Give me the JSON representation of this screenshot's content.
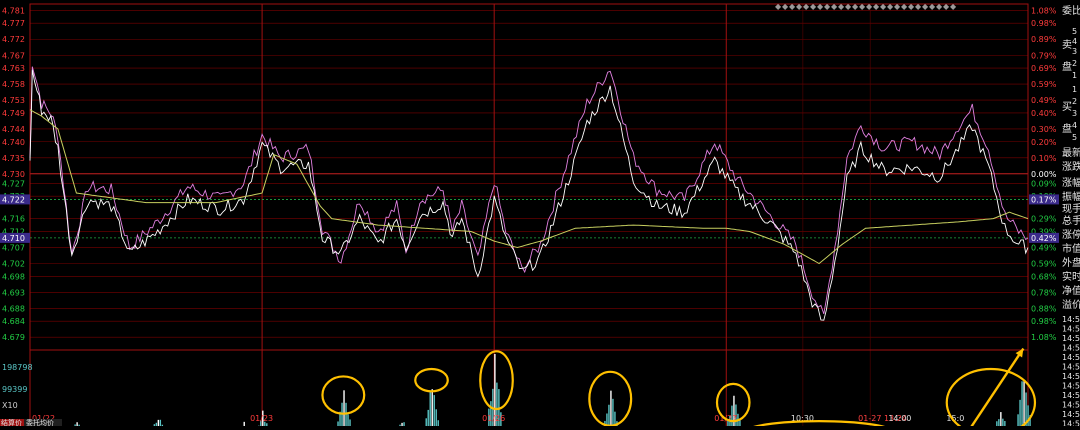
{
  "chart_data": {
    "type": "line",
    "title": "",
    "xlabel": "",
    "ylabel": "",
    "ylim": [
      4.675,
      4.783
    ],
    "pct_ylim": [
      -1.08,
      1.08
    ],
    "base_price": 4.73,
    "grid": true,
    "y_ticks": [
      4.781,
      4.777,
      4.772,
      4.767,
      4.763,
      4.758,
      4.753,
      4.749,
      4.744,
      4.74,
      4.735,
      4.73,
      4.727,
      4.723,
      4.716,
      4.712,
      4.707,
      4.702,
      4.698,
      4.693,
      4.688,
      4.684,
      4.679
    ],
    "y_tick_labels": [
      "4.781",
      "4.777",
      "4.772",
      "4.767",
      "4.763",
      "4.758",
      "4.753",
      "4.749",
      "4.744",
      "4.740",
      "4.735",
      "4.730",
      "4.727",
      "4.723",
      "4.716",
      "4.712",
      "4.707",
      "4.702",
      "4.698",
      "4.693",
      "4.688",
      "4.684",
      "4.679"
    ],
    "pct_ticks": [
      "1.08%",
      "0.98%",
      "0.89%",
      "0.79%",
      "0.69%",
      "0.59%",
      "0.49%",
      "0.40%",
      "0.30%",
      "0.20%",
      "0.10%",
      "0.00%",
      "0.09%",
      "0.19%",
      "0.29%",
      "0.39%",
      "0.49%",
      "0.59%",
      "0.68%",
      "0.78%",
      "0.88%",
      "0.98%",
      "1.08%"
    ],
    "highlight_levels": [
      {
        "value": 4.722,
        "label": "4.722",
        "pct_label": "0.17%",
        "color": "#3a2a8a"
      },
      {
        "value": 4.71,
        "label": "4.710",
        "pct_label": "0.42%",
        "color": "#3a2a8a"
      }
    ],
    "x_labels": [
      {
        "day": 0,
        "label": "01/22"
      },
      {
        "day": 1,
        "label": "01/23"
      },
      {
        "day": 2,
        "label": "01/26"
      },
      {
        "day": 3,
        "label": "01/27"
      },
      {
        "day": 3.33,
        "label": "10:30"
      },
      {
        "day": 3.62,
        "label": "01-27 13:24"
      },
      {
        "day": 3.75,
        "label": "14:00"
      },
      {
        "day": 4.0,
        "label": "15:0"
      }
    ],
    "volume_ticks": [
      "198798",
      "99399",
      "X10"
    ],
    "volume_ylim": [
      0,
      198798
    ],
    "series": [
      {
        "color": "#e080e0",
        "keypoints": [
          [
            0,
            4.735
          ],
          [
            0.01,
            4.765
          ],
          [
            0.05,
            4.752
          ],
          [
            0.09,
            4.749
          ],
          [
            0.12,
            4.742
          ],
          [
            0.18,
            4.705
          ],
          [
            0.25,
            4.726
          ],
          [
            0.35,
            4.725
          ],
          [
            0.43,
            4.707
          ],
          [
            0.55,
            4.715
          ],
          [
            0.68,
            4.726
          ],
          [
            0.82,
            4.722
          ],
          [
            0.92,
            4.727
          ],
          [
            1.0,
            4.742
          ],
          [
            1.08,
            4.735
          ],
          [
            1.2,
            4.738
          ],
          [
            1.26,
            4.713
          ],
          [
            1.34,
            4.703
          ],
          [
            1.42,
            4.722
          ],
          [
            1.5,
            4.712
          ],
          [
            1.58,
            4.72
          ],
          [
            1.62,
            4.706
          ],
          [
            1.68,
            4.722
          ],
          [
            1.78,
            4.725
          ],
          [
            1.82,
            4.712
          ],
          [
            1.86,
            4.72
          ],
          [
            1.93,
            4.703
          ],
          [
            2.0,
            4.728
          ],
          [
            2.05,
            4.712
          ],
          [
            2.12,
            4.7
          ],
          [
            2.2,
            4.708
          ],
          [
            2.32,
            4.735
          ],
          [
            2.4,
            4.752
          ],
          [
            2.5,
            4.763
          ],
          [
            2.6,
            4.735
          ],
          [
            2.7,
            4.725
          ],
          [
            2.82,
            4.722
          ],
          [
            2.95,
            4.74
          ],
          [
            3.05,
            4.728
          ],
          [
            3.2,
            4.716
          ],
          [
            3.3,
            4.708
          ],
          [
            3.37,
            4.693
          ],
          [
            3.42,
            4.685
          ],
          [
            3.48,
            4.713
          ],
          [
            3.52,
            4.735
          ],
          [
            3.58,
            4.745
          ],
          [
            3.68,
            4.738
          ],
          [
            3.8,
            4.74
          ],
          [
            3.92,
            4.736
          ],
          [
            4.0,
            4.745
          ],
          [
            4.06,
            4.75
          ],
          [
            4.13,
            4.738
          ],
          [
            4.2,
            4.717
          ],
          [
            4.26,
            4.712
          ],
          [
            4.3,
            4.71
          ]
        ]
      },
      {
        "color": "#ffffff",
        "keypoints": [
          [
            0,
            4.733
          ],
          [
            0.01,
            4.762
          ],
          [
            0.05,
            4.75
          ],
          [
            0.09,
            4.747
          ],
          [
            0.12,
            4.738
          ],
          [
            0.18,
            4.705
          ],
          [
            0.25,
            4.722
          ],
          [
            0.35,
            4.72
          ],
          [
            0.43,
            4.705
          ],
          [
            0.55,
            4.712
          ],
          [
            0.68,
            4.722
          ],
          [
            0.82,
            4.719
          ],
          [
            0.92,
            4.722
          ],
          [
            1.0,
            4.739
          ],
          [
            1.08,
            4.732
          ],
          [
            1.2,
            4.733
          ],
          [
            1.26,
            4.71
          ],
          [
            1.34,
            4.705
          ],
          [
            1.42,
            4.716
          ],
          [
            1.5,
            4.708
          ],
          [
            1.58,
            4.716
          ],
          [
            1.62,
            4.707
          ],
          [
            1.68,
            4.717
          ],
          [
            1.78,
            4.721
          ],
          [
            1.82,
            4.71
          ],
          [
            1.86,
            4.716
          ],
          [
            1.93,
            4.698
          ],
          [
            2.0,
            4.722
          ],
          [
            2.05,
            4.71
          ],
          [
            2.12,
            4.699
          ],
          [
            2.2,
            4.704
          ],
          [
            2.32,
            4.728
          ],
          [
            2.4,
            4.746
          ],
          [
            2.5,
            4.757
          ],
          [
            2.6,
            4.728
          ],
          [
            2.7,
            4.72
          ],
          [
            2.82,
            4.718
          ],
          [
            2.95,
            4.734
          ],
          [
            3.05,
            4.724
          ],
          [
            3.2,
            4.714
          ],
          [
            3.3,
            4.705
          ],
          [
            3.37,
            4.69
          ],
          [
            3.42,
            4.683
          ],
          [
            3.48,
            4.708
          ],
          [
            3.52,
            4.728
          ],
          [
            3.58,
            4.738
          ],
          [
            3.68,
            4.731
          ],
          [
            3.8,
            4.732
          ],
          [
            3.92,
            4.729
          ],
          [
            4.0,
            4.738
          ],
          [
            4.06,
            4.745
          ],
          [
            4.13,
            4.732
          ],
          [
            4.2,
            4.713
          ],
          [
            4.26,
            4.708
          ],
          [
            4.3,
            4.707
          ]
        ]
      },
      {
        "color": "#c8d060",
        "keypoints": [
          [
            0,
            4.75
          ],
          [
            0.05,
            4.748
          ],
          [
            0.12,
            4.744
          ],
          [
            0.2,
            4.724
          ],
          [
            0.3,
            4.723
          ],
          [
            0.5,
            4.721
          ],
          [
            0.8,
            4.721
          ],
          [
            1.0,
            4.724
          ],
          [
            1.05,
            4.736
          ],
          [
            1.15,
            4.733
          ],
          [
            1.25,
            4.72
          ],
          [
            1.3,
            4.716
          ],
          [
            1.5,
            4.714
          ],
          [
            1.7,
            4.713
          ],
          [
            1.9,
            4.712
          ],
          [
            2.0,
            4.709
          ],
          [
            2.1,
            4.707
          ],
          [
            2.2,
            4.709
          ],
          [
            2.35,
            4.713
          ],
          [
            2.6,
            4.714
          ],
          [
            2.9,
            4.713
          ],
          [
            3.0,
            4.713
          ],
          [
            3.1,
            4.712
          ],
          [
            3.25,
            4.708
          ],
          [
            3.4,
            4.702
          ],
          [
            3.5,
            4.708
          ],
          [
            3.6,
            4.713
          ],
          [
            3.8,
            4.714
          ],
          [
            4.0,
            4.715
          ],
          [
            4.15,
            4.716
          ],
          [
            4.22,
            4.718
          ],
          [
            4.3,
            4.716
          ]
        ]
      }
    ],
    "volume_spikes": [
      {
        "day": 0.02,
        "value": 30000
      },
      {
        "day": 0.2,
        "value": 40000
      },
      {
        "day": 0.55,
        "value": 60000
      },
      {
        "day": 0.92,
        "value": 40000
      },
      {
        "day": 1.0,
        "value": 70000
      },
      {
        "day": 1.06,
        "value": 25000
      },
      {
        "day": 1.35,
        "value": 145000
      },
      {
        "day": 1.6,
        "value": 50000
      },
      {
        "day": 1.73,
        "value": 155000
      },
      {
        "day": 1.84,
        "value": 20000
      },
      {
        "day": 2.0,
        "value": 230000
      },
      {
        "day": 2.35,
        "value": 25000
      },
      {
        "day": 2.5,
        "value": 150000
      },
      {
        "day": 2.65,
        "value": 20000
      },
      {
        "day": 2.85,
        "value": 25000
      },
      {
        "day": 3.03,
        "value": 130000
      },
      {
        "day": 3.6,
        "value": 15000
      },
      {
        "day": 4.18,
        "value": 80000
      },
      {
        "day": 4.28,
        "value": 200000
      }
    ],
    "annotations": [
      {
        "shape": "ellipse",
        "day": 1.35,
        "volume": 110000,
        "rx_days": 0.09,
        "ry_vol": 100000
      },
      {
        "shape": "ellipse",
        "day": 1.73,
        "volume": 150000,
        "rx_days": 0.07,
        "ry_vol": 60000
      },
      {
        "shape": "ellipse",
        "day": 2.01,
        "volume": 150000,
        "rx_days": 0.07,
        "ry_vol": 155000
      },
      {
        "shape": "ellipse",
        "day": 2.5,
        "volume": 100000,
        "rx_days": 0.09,
        "ry_vol": 145000
      },
      {
        "shape": "ellipse",
        "day": 3.03,
        "volume": 90000,
        "rx_days": 0.07,
        "ry_vol": 100000
      },
      {
        "shape": "ellipse",
        "day": 3.4,
        "volume": 10000,
        "rx_days": 0.32,
        "ry_vol": 60000
      },
      {
        "shape": "ellipse",
        "day": 4.14,
        "volume": 90000,
        "rx_days": 0.19,
        "ry_vol": 180000
      },
      {
        "shape": "arrow",
        "from_day": 4.04,
        "from_vol": 10000,
        "to_day": 4.28,
        "to_vol": 235000
      }
    ]
  },
  "right_panel": {
    "labels": [
      "委比",
      "卖",
      "盘",
      "买",
      "盘",
      "最新",
      "涨跌",
      "涨幅",
      "振幅",
      "现手",
      "总手",
      "涨停",
      "市值",
      "外盘",
      "实时",
      "净值",
      "溢价"
    ],
    "numbers": [
      "5",
      "4",
      "3",
      "2",
      "1",
      "1",
      "2",
      "3",
      "4",
      "5"
    ],
    "time_rows": [
      "14:5",
      "14:5",
      "14:5",
      "14:5",
      "14:5",
      "14:5",
      "14:5",
      "14:5",
      "14:5",
      "14:5",
      "14:5",
      "14:5"
    ]
  },
  "bottom_tabs": [
    "结算价",
    "委托均价"
  ],
  "colors": {
    "grid": "#7a0000",
    "price_up": "#ff3b3b",
    "price_down": "#22cc44",
    "volume": "#5ac6c6",
    "annotation": "#ffc000"
  }
}
